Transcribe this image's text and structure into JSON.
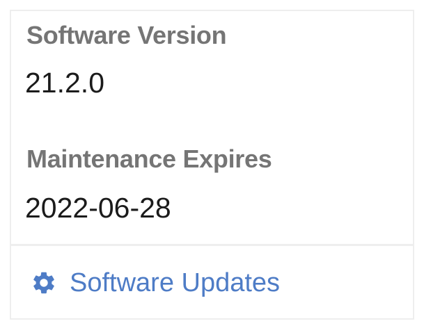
{
  "info": {
    "software_version_label": "Software Version",
    "software_version_value": "21.2.0",
    "maintenance_label": "Maintenance Expires",
    "maintenance_value": "2022-06-28"
  },
  "link": {
    "label": "Software Updates",
    "icon": "gear-icon"
  },
  "colors": {
    "label": "#757575",
    "value": "#1b1b1b",
    "link": "#4e7cc6",
    "border": "#eeeeee"
  }
}
